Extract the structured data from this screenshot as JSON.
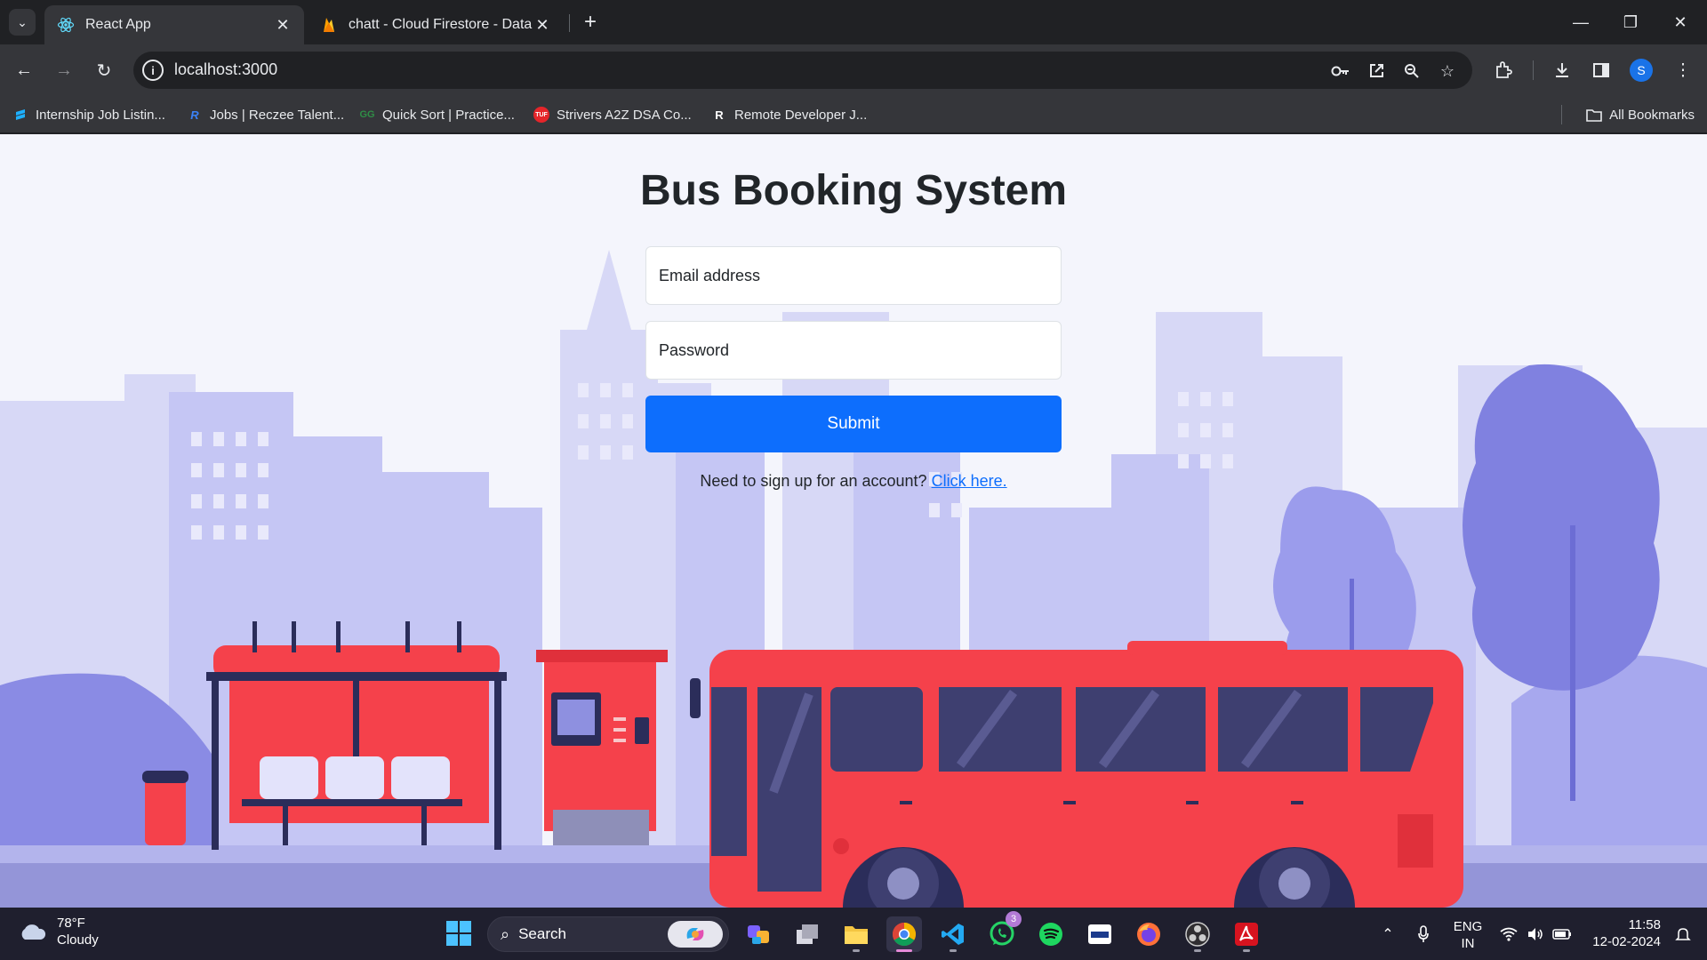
{
  "browser": {
    "tabs": [
      {
        "title": "React App",
        "active": true
      },
      {
        "title": "chatt - Cloud Firestore - Data -",
        "active": false
      }
    ],
    "url": "localhost:3000",
    "profile_initial": "S",
    "bookmarks": [
      {
        "label": "Internship Job Listin...",
        "icon_color": "#1db0ff"
      },
      {
        "label": "Jobs | Reczee Talent...",
        "icon_color": "#3b82f6"
      },
      {
        "label": "Quick Sort | Practice...",
        "icon_color": "#2f8d46"
      },
      {
        "label": "Strivers A2Z DSA Co...",
        "icon_color": "#e5252a"
      },
      {
        "label": "Remote Developer J...",
        "icon_color": "#ffffff"
      }
    ],
    "all_bookmarks_label": "All Bookmarks"
  },
  "page": {
    "title": "Bus Booking System",
    "email_placeholder": "Email address",
    "password_placeholder": "Password",
    "submit_label": "Submit",
    "signup_text": "Need to sign up for an account?",
    "signup_link": "Click here."
  },
  "taskbar": {
    "weather_temp": "78°F",
    "weather_desc": "Cloudy",
    "search_label": "Search",
    "whatsapp_badge": "3",
    "lang_1": "ENG",
    "lang_2": "IN",
    "time": "11:58",
    "date": "12-02-2024"
  },
  "colors": {
    "accent": "#0d6efd",
    "bus_red": "#f5414b",
    "scene_purple": "#8788e6"
  }
}
